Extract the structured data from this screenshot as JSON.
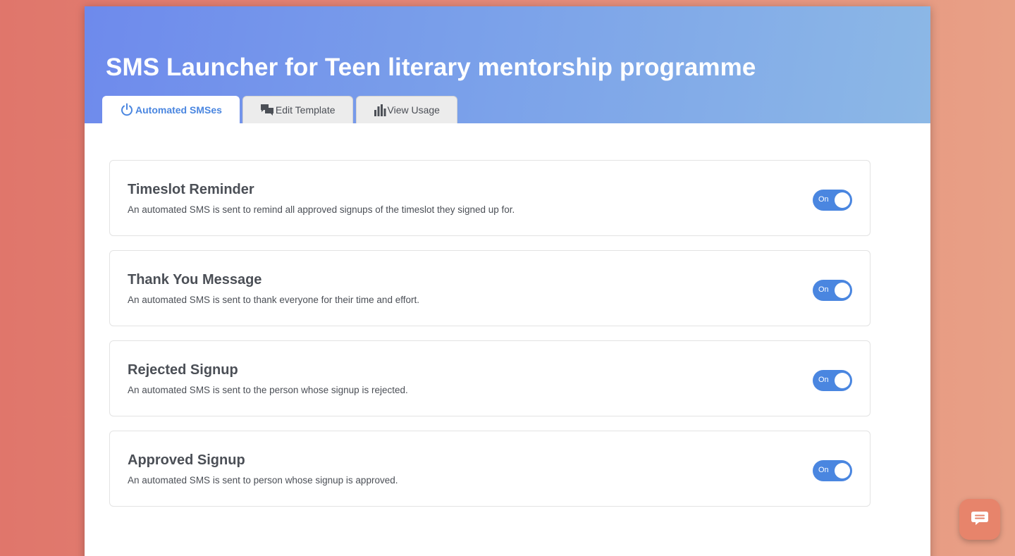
{
  "header": {
    "title": "SMS Launcher for Teen literary mentorship programme"
  },
  "tabs": [
    {
      "label": "Automated SMSes",
      "icon": "power-icon",
      "active": true
    },
    {
      "label": "Edit Template",
      "icon": "chat-bubbles-icon",
      "active": false
    },
    {
      "label": "View Usage",
      "icon": "bar-chart-icon",
      "active": false
    }
  ],
  "cards": [
    {
      "title": "Timeslot Reminder",
      "description": "An automated SMS is sent to remind all approved signups of the timeslot they signed up for.",
      "toggle_label": "On"
    },
    {
      "title": "Thank You Message",
      "description": "An automated SMS is sent to thank everyone for their time and effort.",
      "toggle_label": "On"
    },
    {
      "title": "Rejected Signup",
      "description": "An automated SMS is sent to the person whose signup is rejected.",
      "toggle_label": "On"
    },
    {
      "title": "Approved Signup",
      "description": "An automated SMS is sent to person whose signup is approved.",
      "toggle_label": "On"
    }
  ],
  "colors": {
    "accent": "#4a86e0",
    "text": "#4b4f56",
    "chat_button": "#e7846b"
  },
  "chat_widget": {
    "icon": "chat-icon"
  }
}
